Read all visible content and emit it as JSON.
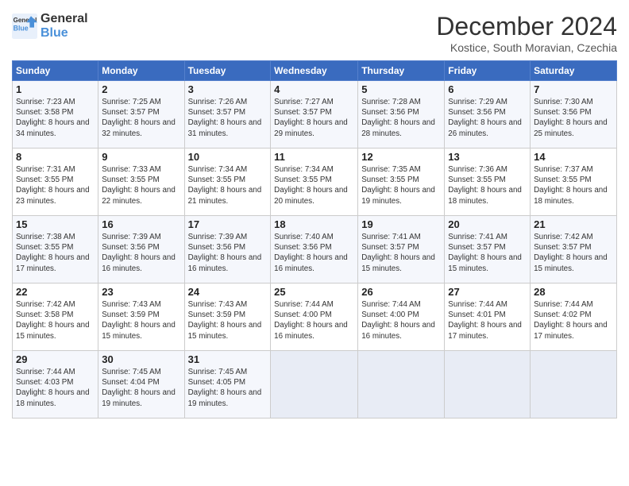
{
  "logo": {
    "line1": "General",
    "line2": "Blue"
  },
  "title": "December 2024",
  "subtitle": "Kostice, South Moravian, Czechia",
  "weekdays": [
    "Sunday",
    "Monday",
    "Tuesday",
    "Wednesday",
    "Thursday",
    "Friday",
    "Saturday"
  ],
  "weeks": [
    [
      {
        "day": "1",
        "info": "Sunrise: 7:23 AM\nSunset: 3:58 PM\nDaylight: 8 hours and 34 minutes."
      },
      {
        "day": "2",
        "info": "Sunrise: 7:25 AM\nSunset: 3:57 PM\nDaylight: 8 hours and 32 minutes."
      },
      {
        "day": "3",
        "info": "Sunrise: 7:26 AM\nSunset: 3:57 PM\nDaylight: 8 hours and 31 minutes."
      },
      {
        "day": "4",
        "info": "Sunrise: 7:27 AM\nSunset: 3:57 PM\nDaylight: 8 hours and 29 minutes."
      },
      {
        "day": "5",
        "info": "Sunrise: 7:28 AM\nSunset: 3:56 PM\nDaylight: 8 hours and 28 minutes."
      },
      {
        "day": "6",
        "info": "Sunrise: 7:29 AM\nSunset: 3:56 PM\nDaylight: 8 hours and 26 minutes."
      },
      {
        "day": "7",
        "info": "Sunrise: 7:30 AM\nSunset: 3:56 PM\nDaylight: 8 hours and 25 minutes."
      }
    ],
    [
      {
        "day": "8",
        "info": "Sunrise: 7:31 AM\nSunset: 3:55 PM\nDaylight: 8 hours and 23 minutes."
      },
      {
        "day": "9",
        "info": "Sunrise: 7:33 AM\nSunset: 3:55 PM\nDaylight: 8 hours and 22 minutes."
      },
      {
        "day": "10",
        "info": "Sunrise: 7:34 AM\nSunset: 3:55 PM\nDaylight: 8 hours and 21 minutes."
      },
      {
        "day": "11",
        "info": "Sunrise: 7:34 AM\nSunset: 3:55 PM\nDaylight: 8 hours and 20 minutes."
      },
      {
        "day": "12",
        "info": "Sunrise: 7:35 AM\nSunset: 3:55 PM\nDaylight: 8 hours and 19 minutes."
      },
      {
        "day": "13",
        "info": "Sunrise: 7:36 AM\nSunset: 3:55 PM\nDaylight: 8 hours and 18 minutes."
      },
      {
        "day": "14",
        "info": "Sunrise: 7:37 AM\nSunset: 3:55 PM\nDaylight: 8 hours and 18 minutes."
      }
    ],
    [
      {
        "day": "15",
        "info": "Sunrise: 7:38 AM\nSunset: 3:55 PM\nDaylight: 8 hours and 17 minutes."
      },
      {
        "day": "16",
        "info": "Sunrise: 7:39 AM\nSunset: 3:56 PM\nDaylight: 8 hours and 16 minutes."
      },
      {
        "day": "17",
        "info": "Sunrise: 7:39 AM\nSunset: 3:56 PM\nDaylight: 8 hours and 16 minutes."
      },
      {
        "day": "18",
        "info": "Sunrise: 7:40 AM\nSunset: 3:56 PM\nDaylight: 8 hours and 16 minutes."
      },
      {
        "day": "19",
        "info": "Sunrise: 7:41 AM\nSunset: 3:57 PM\nDaylight: 8 hours and 15 minutes."
      },
      {
        "day": "20",
        "info": "Sunrise: 7:41 AM\nSunset: 3:57 PM\nDaylight: 8 hours and 15 minutes."
      },
      {
        "day": "21",
        "info": "Sunrise: 7:42 AM\nSunset: 3:57 PM\nDaylight: 8 hours and 15 minutes."
      }
    ],
    [
      {
        "day": "22",
        "info": "Sunrise: 7:42 AM\nSunset: 3:58 PM\nDaylight: 8 hours and 15 minutes."
      },
      {
        "day": "23",
        "info": "Sunrise: 7:43 AM\nSunset: 3:59 PM\nDaylight: 8 hours and 15 minutes."
      },
      {
        "day": "24",
        "info": "Sunrise: 7:43 AM\nSunset: 3:59 PM\nDaylight: 8 hours and 15 minutes."
      },
      {
        "day": "25",
        "info": "Sunrise: 7:44 AM\nSunset: 4:00 PM\nDaylight: 8 hours and 16 minutes."
      },
      {
        "day": "26",
        "info": "Sunrise: 7:44 AM\nSunset: 4:00 PM\nDaylight: 8 hours and 16 minutes."
      },
      {
        "day": "27",
        "info": "Sunrise: 7:44 AM\nSunset: 4:01 PM\nDaylight: 8 hours and 17 minutes."
      },
      {
        "day": "28",
        "info": "Sunrise: 7:44 AM\nSunset: 4:02 PM\nDaylight: 8 hours and 17 minutes."
      }
    ],
    [
      {
        "day": "29",
        "info": "Sunrise: 7:44 AM\nSunset: 4:03 PM\nDaylight: 8 hours and 18 minutes."
      },
      {
        "day": "30",
        "info": "Sunrise: 7:45 AM\nSunset: 4:04 PM\nDaylight: 8 hours and 19 minutes."
      },
      {
        "day": "31",
        "info": "Sunrise: 7:45 AM\nSunset: 4:05 PM\nDaylight: 8 hours and 19 minutes."
      },
      {
        "day": "",
        "info": ""
      },
      {
        "day": "",
        "info": ""
      },
      {
        "day": "",
        "info": ""
      },
      {
        "day": "",
        "info": ""
      }
    ]
  ]
}
